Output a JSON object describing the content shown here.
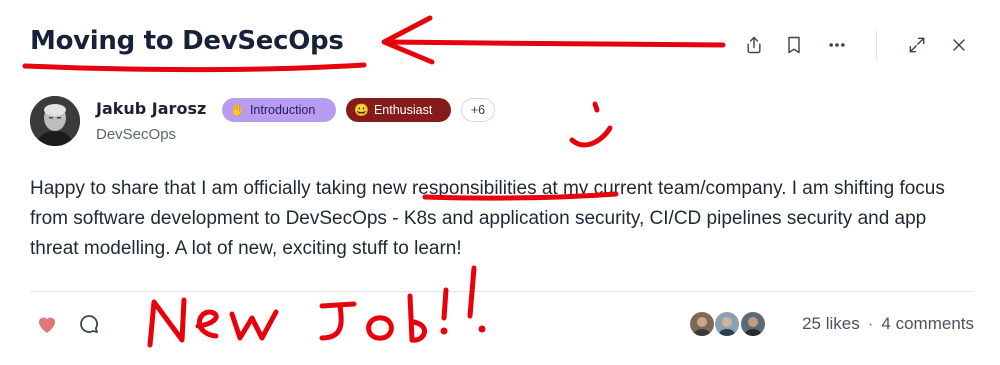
{
  "post": {
    "title": "Moving to DevSecOps",
    "body": "Happy to share that I am officially taking new responsibilities at my current team/company. I am shifting focus from software development to DevSecOps - K8s and application security, CI/CD pipelines security and app threat modelling. A lot of new, exciting stuff to learn!"
  },
  "toolbar": {
    "icons": [
      "share-icon",
      "bookmark-icon",
      "more-icon",
      "expand-icon",
      "close-icon"
    ]
  },
  "author": {
    "name": "Jakub Jarosz",
    "group": "DevSecOps",
    "badges": [
      {
        "emoji": "✋",
        "label": "Introduction",
        "color": "#b79cf0"
      },
      {
        "emoji": "😀",
        "label": "Enthusiast",
        "color": "#861c1a"
      }
    ],
    "more_badges": "+6"
  },
  "footer": {
    "likes": "25 likes",
    "separator": "·",
    "comments": "4 comments",
    "heart_color": "#e0787a"
  },
  "annotations": {
    "handwritten_text": "New Job!!",
    "ink_color": "#e8000b"
  }
}
